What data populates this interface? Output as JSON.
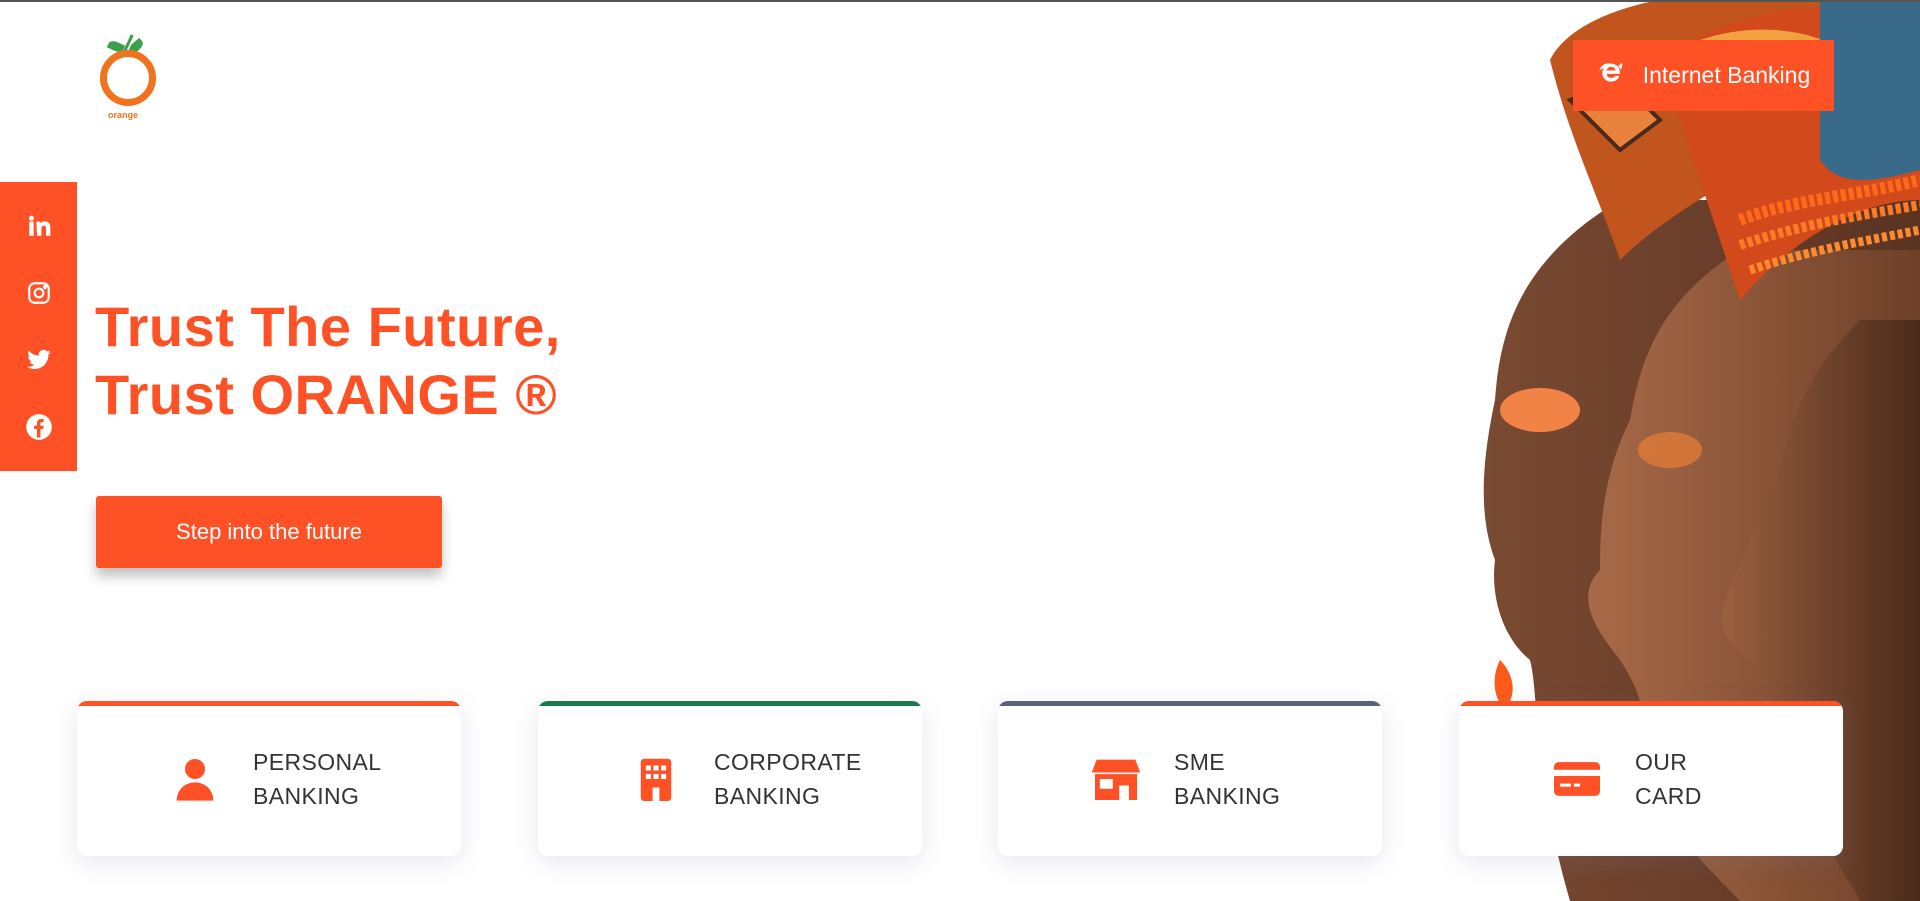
{
  "brand": {
    "logo_text": "orange",
    "accent_color": "#ff5126"
  },
  "header": {
    "internet_banking_label": "Internet Banking",
    "internet_banking_icon": "internet-explorer-icon"
  },
  "social": [
    {
      "name": "linkedin",
      "icon": "linkedin-icon"
    },
    {
      "name": "instagram",
      "icon": "instagram-icon"
    },
    {
      "name": "twitter",
      "icon": "twitter-icon"
    },
    {
      "name": "facebook",
      "icon": "facebook-icon"
    }
  ],
  "hero": {
    "headline_line1": "Trust The Future,",
    "headline_line2": "Trust ORANGE ®",
    "cta_label": "Step into the future"
  },
  "cards": [
    {
      "line1": "PERSONAL",
      "line2": "BANKING",
      "icon": "user-icon",
      "bar_color": "#ff5126"
    },
    {
      "line1": "CORPORATE",
      "line2": "BANKING",
      "icon": "building-icon",
      "bar_color": "#1a7a4a"
    },
    {
      "line1": "SME",
      "line2": "BANKING",
      "icon": "store-icon",
      "bar_color": "#5a6278"
    },
    {
      "line1": "OUR",
      "line2": "CARD",
      "icon": "credit-card-icon",
      "bar_color": "#ff5126"
    }
  ]
}
